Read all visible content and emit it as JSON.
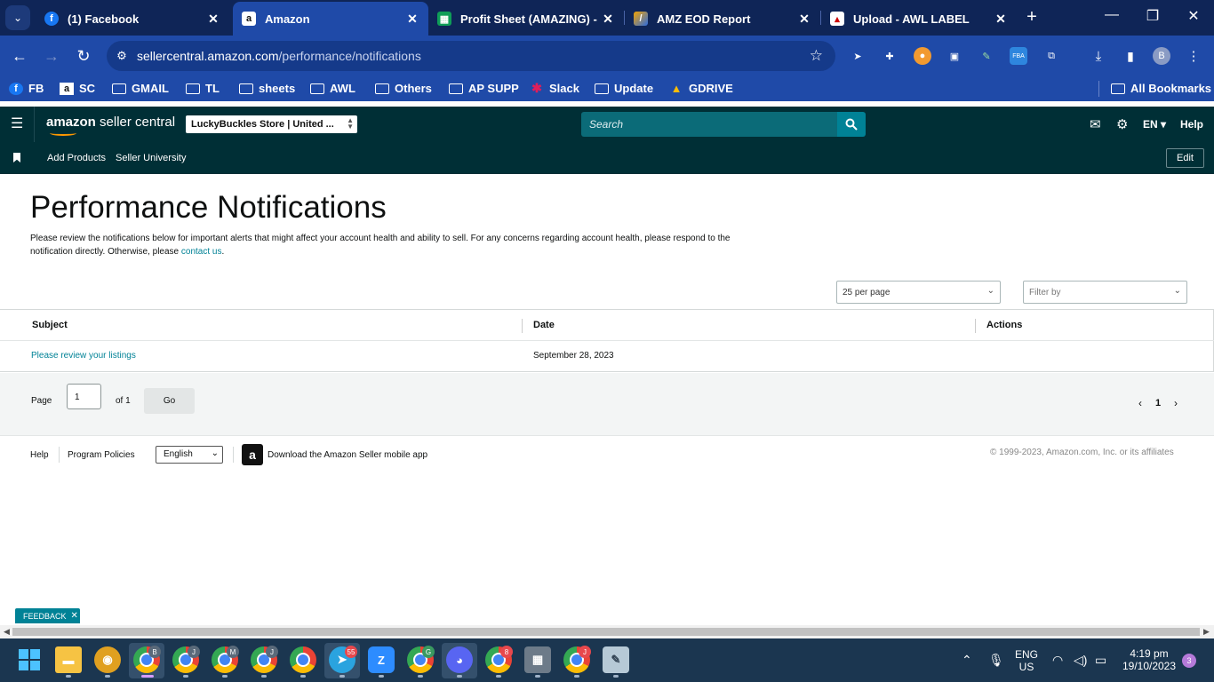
{
  "browser": {
    "tabs": [
      {
        "title": "(1) Facebook",
        "icon": "facebook-icon"
      },
      {
        "title": "Amazon",
        "icon": "amazon-icon"
      },
      {
        "title": "Profit Sheet (AMAZING) - G",
        "icon": "google-sheets-icon"
      },
      {
        "title": "AMZ EOD Report",
        "icon": "report-icon"
      },
      {
        "title": "Upload - AWL LABEL",
        "icon": "label-icon"
      }
    ],
    "url_host": "sellercentral.amazon.com",
    "url_path": "/performance/notifications",
    "profile_initial": "B",
    "ext_fba": "FBA",
    "bookmarks": [
      "FB",
      "SC",
      "GMAIL",
      "TL",
      "sheets",
      "AWL",
      "Others",
      "AP SUPP",
      "Slack",
      "Update",
      "GDRIVE"
    ],
    "all_bookmarks": "All Bookmarks"
  },
  "header": {
    "logo_bold": "amazon",
    "logo_rest": " seller central",
    "store": "LuckyBuckles Store | United ...",
    "search_placeholder": "Search",
    "language": "EN",
    "help": "Help",
    "sub_links": [
      "Add Products",
      "Seller University"
    ],
    "edit": "Edit"
  },
  "page": {
    "title": "Performance Notifications",
    "intro_line1": "Please review the notifications below for important alerts that might affect your account health and ability to sell. For any concerns regarding account health, please respond to the",
    "intro_line2_pre": "notification directly. Otherwise, please ",
    "intro_link": "contact us",
    "intro_line2_post": ".",
    "per_page": "25 per page",
    "filter": "Filter by",
    "columns": [
      "Subject",
      "Date",
      "Actions"
    ],
    "rows": [
      {
        "subject": "Please review your listings",
        "date": "September 28, 2023",
        "actions": ""
      }
    ],
    "page_label": "Page",
    "page_value": "1",
    "of_label": "of 1",
    "go": "Go",
    "current_page": "1"
  },
  "footer": {
    "help": "Help",
    "policies": "Program Policies",
    "language": "English",
    "app_text": "Download the Amazon Seller mobile app",
    "copyright": "© 1999-2023, Amazon.com, Inc. or its affiliates"
  },
  "feedback": "FEEDBACK",
  "taskbar": {
    "lang_top": "ENG",
    "lang_bottom": "US",
    "time": "4:19 pm",
    "date": "19/10/2023",
    "notifications": "3",
    "badges": [
      "B",
      "J",
      "M",
      "J",
      "55",
      "G",
      "8",
      "J"
    ]
  }
}
